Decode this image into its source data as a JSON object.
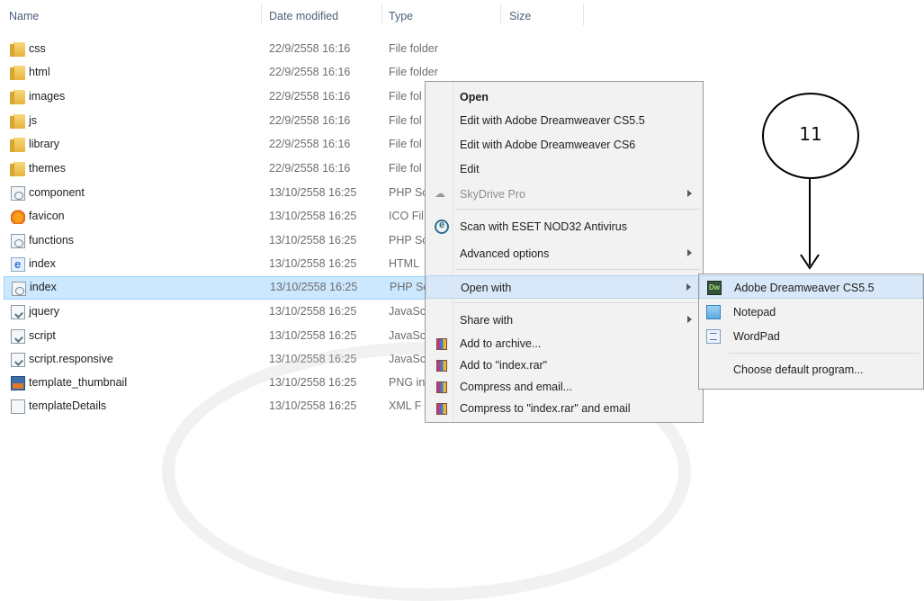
{
  "columns": {
    "name": "Name",
    "date_modified": "Date modified",
    "type": "Type",
    "size": "Size"
  },
  "files": [
    {
      "name": "css",
      "date": "22/9/2558 16:16",
      "type": "File folder",
      "icon": "folder"
    },
    {
      "name": "html",
      "date": "22/9/2558 16:16",
      "type": "File folder",
      "icon": "folder"
    },
    {
      "name": "images",
      "date": "22/9/2558 16:16",
      "type": "File fol",
      "icon": "folder"
    },
    {
      "name": "js",
      "date": "22/9/2558 16:16",
      "type": "File fol",
      "icon": "folder"
    },
    {
      "name": "library",
      "date": "22/9/2558 16:16",
      "type": "File fol",
      "icon": "folder"
    },
    {
      "name": "themes",
      "date": "22/9/2558 16:16",
      "type": "File fol",
      "icon": "folder"
    },
    {
      "name": "component",
      "date": "13/10/2558 16:25",
      "type": "PHP Sc",
      "icon": "php-file"
    },
    {
      "name": "favicon",
      "date": "13/10/2558 16:25",
      "type": "ICO Fil",
      "icon": "ico-file"
    },
    {
      "name": "functions",
      "date": "13/10/2558 16:25",
      "type": "PHP Sc",
      "icon": "php-file"
    },
    {
      "name": "index",
      "date": "13/10/2558 16:25",
      "type": "HTML",
      "icon": "html-file"
    },
    {
      "name": "index",
      "date": "13/10/2558 16:25",
      "type": "PHP Sc",
      "icon": "php-file",
      "selected": true
    },
    {
      "name": "jquery",
      "date": "13/10/2558 16:25",
      "type": "JavaSc",
      "icon": "js-file"
    },
    {
      "name": "script",
      "date": "13/10/2558 16:25",
      "type": "JavaSc",
      "icon": "js-file"
    },
    {
      "name": "script.responsive",
      "date": "13/10/2558 16:25",
      "type": "JavaSc",
      "icon": "js-file"
    },
    {
      "name": "template_thumbnail",
      "date": "13/10/2558 16:25",
      "type": "PNG in",
      "icon": "png-file"
    },
    {
      "name": "templateDetails",
      "date": "13/10/2558 16:25",
      "type": "XML F",
      "icon": "xml-file"
    }
  ],
  "context_menu": {
    "open": "Open",
    "edit_dw55": "Edit with Adobe Dreamweaver CS5.5",
    "edit_dw6": "Edit with Adobe Dreamweaver CS6",
    "edit": "Edit",
    "skydrive": "SkyDrive Pro",
    "scan": "Scan with ESET NOD32 Antivirus",
    "advanced": "Advanced options",
    "open_with": "Open with",
    "share_with": "Share with",
    "add_archive": "Add to archive...",
    "add_rar": "Add to \"index.rar\"",
    "compress_email": "Compress and email...",
    "compress_rar_email": "Compress to \"index.rar\" and email"
  },
  "open_with_menu": {
    "dreamweaver": "Adobe Dreamweaver CS5.5",
    "notepad": "Notepad",
    "wordpad": "WordPad",
    "choose": "Choose default program..."
  },
  "annotation": {
    "step": "11"
  }
}
